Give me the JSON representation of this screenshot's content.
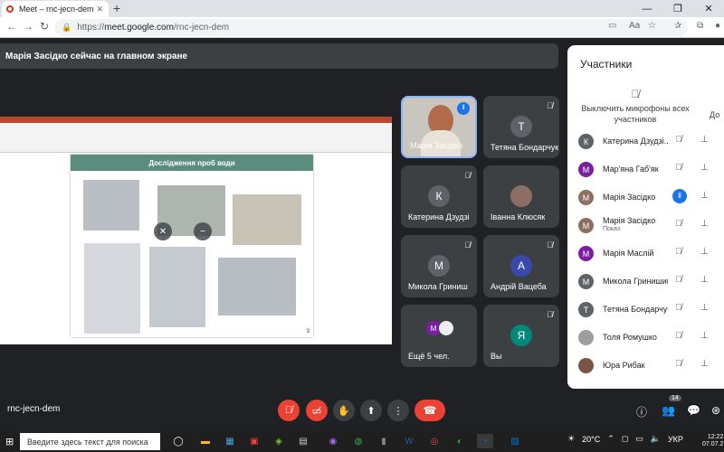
{
  "browser": {
    "tab_title": "Meet – rnc-jecn-dem",
    "tab_close": "✕",
    "new_tab": "+",
    "url_host": "https://",
    "url_domain": "meet.google.com",
    "url_path": "/rnc-jecn-dem"
  },
  "banner": {
    "text": "Марія Засідко сейчас на главном экране"
  },
  "presentation": {
    "slide_title": "Дослідження проб води",
    "slide_number": "3"
  },
  "tiles": [
    {
      "name": "Марія Засідко",
      "avatar": "",
      "color": "#8bc34a",
      "speaking": true
    },
    {
      "name": "Тетяна Бондарчук",
      "avatar": "Т",
      "color": "#5f6368"
    },
    {
      "name": "Катерина Дзудзі",
      "avatar": "К",
      "color": "#5f6368"
    },
    {
      "name": "Івaнна Клюсяк",
      "avatar": "",
      "color": "#8d6e63"
    },
    {
      "name": "Микола Гриниш",
      "avatar": "М",
      "color": "#5f6368"
    },
    {
      "name": "Андрій Вацеба",
      "avatar": "А",
      "color": "#3949ab"
    },
    {
      "name": "Ещё 5 чел.",
      "avatar": "М",
      "color": "#7b1fa2"
    },
    {
      "name": "Вы",
      "avatar": "Я",
      "color": "#00897b"
    }
  ],
  "panel": {
    "title": "Участники",
    "mute_all": "Выключить микрофоны всех участников",
    "more": "До",
    "participants": [
      {
        "name": "Катерина Дзудзі...",
        "avatar": "К",
        "color": "#5f6368",
        "sub": ""
      },
      {
        "name": "Мар'яна Габ'як",
        "avatar": "М",
        "color": "#7b1fa2",
        "sub": ""
      },
      {
        "name": "Марія Засідко",
        "avatar": "М",
        "color": "#8d6e63",
        "sub": "",
        "speaking": true
      },
      {
        "name": "Марія Засідко",
        "avatar": "М",
        "color": "#8d6e63",
        "sub": "Показ"
      },
      {
        "name": "Марія Маслій",
        "avatar": "М",
        "color": "#7b1fa2",
        "sub": ""
      },
      {
        "name": "Микола Гринишин",
        "avatar": "М",
        "color": "#5f6368",
        "sub": ""
      },
      {
        "name": "Тетяна Бондарчук",
        "avatar": "Т",
        "color": "#5f6368",
        "sub": ""
      },
      {
        "name": "Толя Ромушко",
        "avatar": "",
        "color": "#9e9e9e",
        "sub": ""
      },
      {
        "name": "Юра Рибак",
        "avatar": "",
        "color": "#795548",
        "sub": ""
      }
    ]
  },
  "bottom": {
    "meeting_code": "rnc-jecn-dem",
    "participants_count": "14"
  },
  "taskbar": {
    "search_placeholder": "Введите здесь текст для поиска",
    "temperature": "20°C",
    "language": "УКР",
    "time": "12:22",
    "date": "07.07.2"
  }
}
